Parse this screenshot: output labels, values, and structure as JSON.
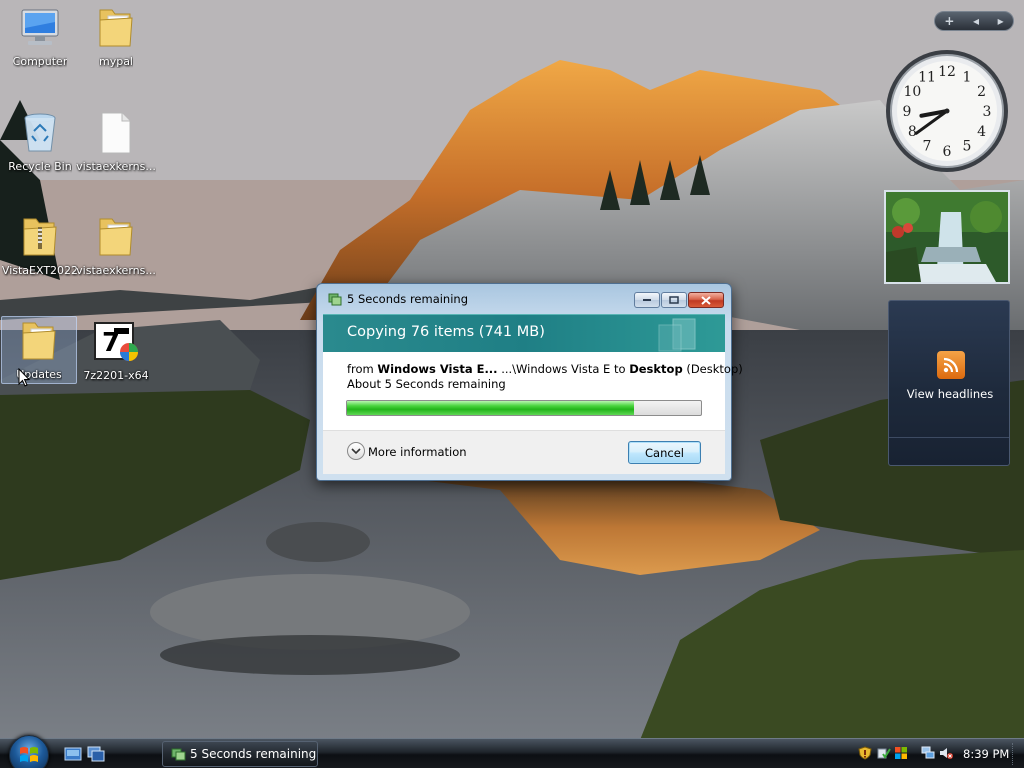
{
  "desktop": {
    "icons": [
      {
        "label": "Computer",
        "icon": "computer-icon"
      },
      {
        "label": "mypal",
        "icon": "folder-icon"
      },
      {
        "label": "Recycle Bin",
        "icon": "recycle-bin-icon"
      },
      {
        "label": "vistaexkerns...",
        "icon": "document-icon"
      },
      {
        "label": "VistaEXT2022",
        "icon": "zip-folder-icon"
      },
      {
        "label": "vistaexkerns...",
        "icon": "folder-icon"
      },
      {
        "label": "Updates",
        "icon": "folder-icon",
        "selected": true
      },
      {
        "label": "7z2201-x64",
        "icon": "7zip-installer-icon"
      }
    ]
  },
  "gadgets": {
    "controls": {
      "add": "+",
      "prev": "◂",
      "next": "▸"
    },
    "clock": {
      "hour": 8,
      "minute": 39,
      "numerals": [
        "12",
        "1",
        "2",
        "3",
        "4",
        "5",
        "6",
        "7",
        "8",
        "9",
        "10",
        "11"
      ]
    },
    "feed": {
      "label": "View headlines",
      "icon": "rss-feed-icon"
    }
  },
  "dialog": {
    "title": "5 Seconds remaining",
    "header": "Copying 76 items (741 MB)",
    "from_prefix": "from",
    "source_name": "Windows Vista E...",
    "source_path": "...\\Windows Vista E",
    "to_prefix": "to",
    "dest_name": "Desktop",
    "dest_path": "(Desktop)",
    "remaining": "About 5 Seconds remaining",
    "progress_fraction": 0.81,
    "more_info": "More information",
    "cancel": "Cancel",
    "colors": {
      "header": "#1f7f85",
      "progress": "#22b41a"
    }
  },
  "taskbar": {
    "task_title": "5 Seconds remaining",
    "clock": "8:39 PM"
  }
}
